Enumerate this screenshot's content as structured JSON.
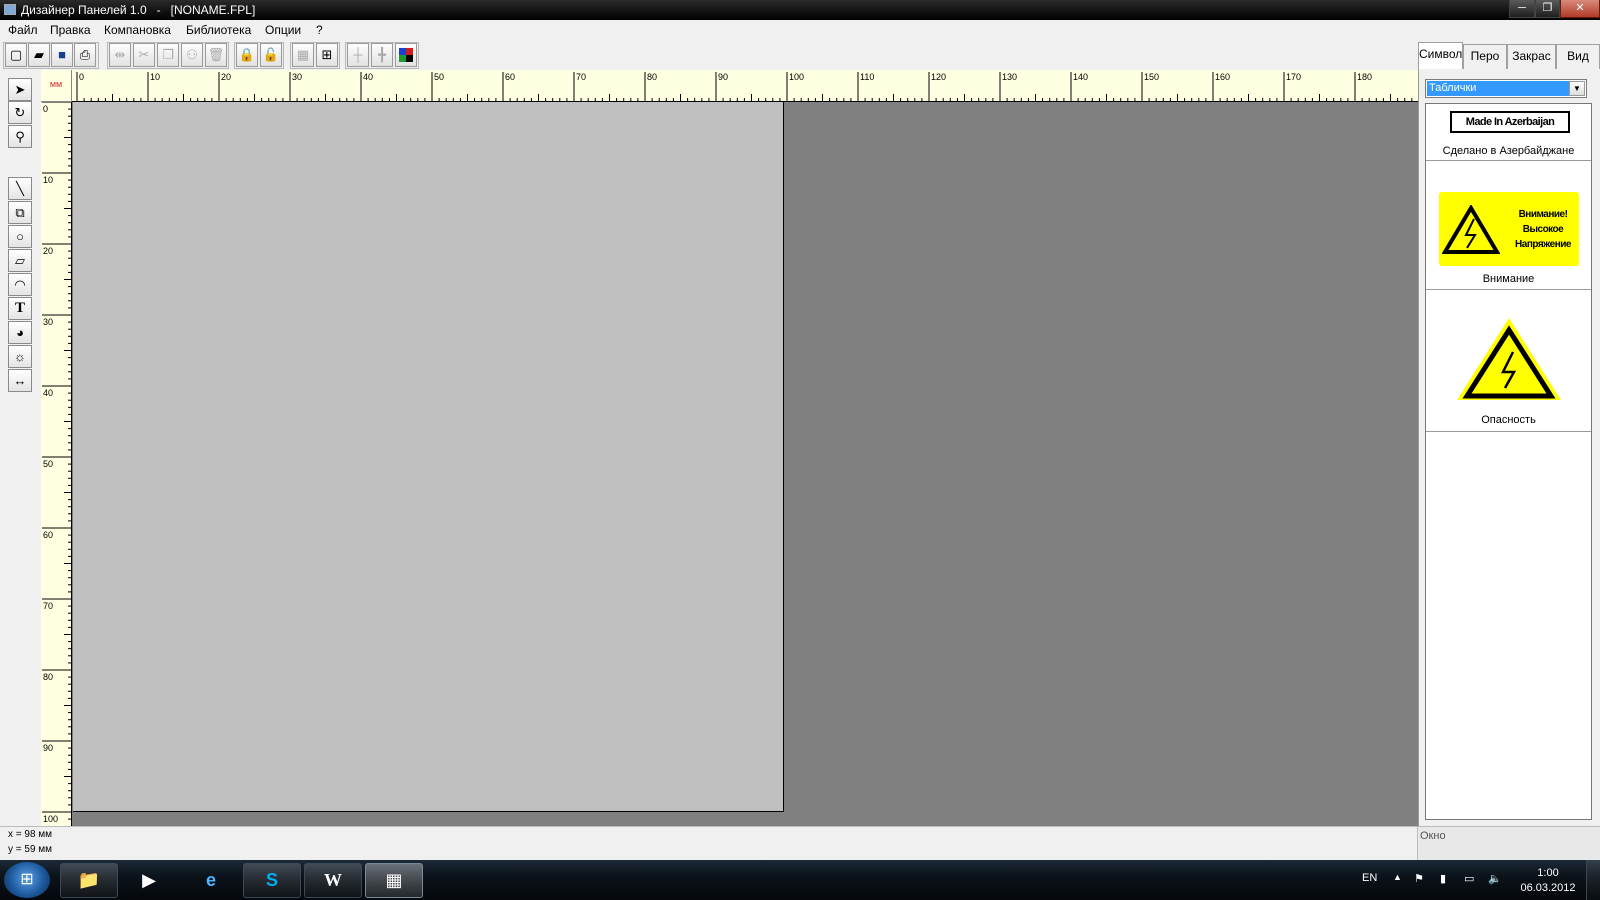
{
  "window": {
    "title": "Дизайнер Панелей 1.0   -   [NONAME.FPL]",
    "buttons": {
      "minimize": "─",
      "maximize": "❐",
      "close": "✕"
    }
  },
  "menu": [
    "Файл",
    "Правка",
    "Компановка",
    "Библиотека",
    "Опции",
    "?"
  ],
  "toolbar": {
    "icons": [
      "new-icon",
      "open-icon",
      "save-icon",
      "print-icon",
      "align-icon",
      "cut-icon",
      "copy-icon",
      "group-icon",
      "delete-icon",
      "lock-icon",
      "unlock-icon",
      "grid-icon",
      "size-icon",
      "snap-icon",
      "center-icon",
      "color-icon"
    ]
  },
  "tools": [
    "pointer-icon",
    "rotate-icon",
    "zoom-icon",
    "line-icon",
    "rectangle-icon",
    "circle-icon",
    "polygon-icon",
    "arc-icon",
    "text-icon",
    "fill-icon",
    "dial-icon",
    "dimension-icon"
  ],
  "ruler": {
    "unit": "мм",
    "h_labels": [
      "0",
      "10",
      "20",
      "30",
      "40",
      "50",
      "60",
      "70",
      "80",
      "90",
      "100",
      "110",
      "120",
      "130",
      "140",
      "150",
      "160",
      "170",
      "180"
    ],
    "v_labels": [
      "0",
      "10",
      "20",
      "30",
      "40",
      "50",
      "60",
      "70",
      "80",
      "90",
      "100"
    ]
  },
  "side_tabs": [
    "Символ",
    "Перо",
    "Закрас",
    "Вид"
  ],
  "side_active_tab": "Символ",
  "library": {
    "selected": "Таблички",
    "items": [
      {
        "text": "Made In Azerbaijan",
        "label": "Сделано в Азербайджане"
      },
      {
        "text_lines": [
          "Внимание!",
          "Высокое",
          "Напряжение"
        ],
        "label": "Внимание"
      },
      {
        "label": "Опасность"
      }
    ]
  },
  "status": {
    "x": "x = 98 мм",
    "y": "y = 59 мм",
    "right": "Окно"
  },
  "taskbar": {
    "lang": "EN",
    "time": "1:00",
    "date": "06.03.2012",
    "apps": [
      "explorer-icon",
      "media-player-icon",
      "internet-explorer-icon",
      "skype-icon",
      "word-icon",
      "panel-designer-icon"
    ]
  },
  "colors": {
    "warning_yellow": "#ffff00",
    "page_gray": "#c0c0c0",
    "work_gray": "#808080",
    "ruler_bg": "#ffffe1"
  }
}
